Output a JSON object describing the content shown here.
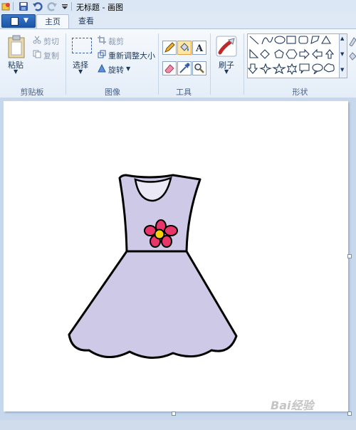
{
  "window": {
    "title": "无标题 - 画图"
  },
  "quick_access": {
    "icons": [
      "paint-app-icon",
      "save-icon",
      "undo-icon",
      "redo-icon",
      "customize-arrow-icon"
    ]
  },
  "tabs": [
    {
      "label": "主页",
      "selected": true
    },
    {
      "label": "查看",
      "selected": false
    }
  ],
  "ribbon": {
    "clipboard": {
      "paste": "粘贴",
      "cut": "剪切",
      "copy": "复制",
      "group": "剪贴板"
    },
    "image": {
      "select": "选择",
      "crop": "裁剪",
      "resize": "重新调整大小",
      "rotate": "旋转",
      "group": "图像"
    },
    "tools": {
      "group": "工具",
      "icons": [
        "pencil-icon",
        "fill-icon",
        "text-icon",
        "eraser-icon",
        "color-picker-icon",
        "magnifier-icon"
      ]
    },
    "brushes": {
      "label": "刷子"
    },
    "shapes": {
      "group": "形状"
    }
  },
  "canvas": {
    "drawing": "dress",
    "dress_color": "#cdc9e6",
    "neckline_color": "#ebe9f5",
    "flower_petal_color": "#e8366a",
    "flower_center_color": "#f5d20a"
  },
  "watermark": {
    "text": "Bai经验"
  }
}
